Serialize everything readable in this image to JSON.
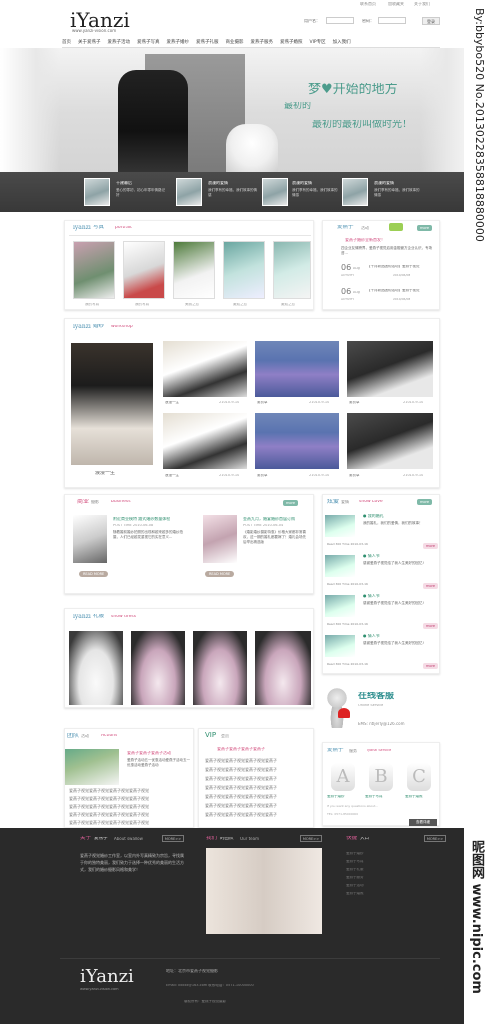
{
  "header": {
    "logo": "iYanzi",
    "logo_sub": "www.yanzi-vision.com",
    "toplinks": [
      "联系首页",
      "加收藏夹",
      "关于我们"
    ],
    "user_label": "用户名：",
    "pass_label": "密码：",
    "login_btn": "登录"
  },
  "nav": [
    "首页",
    "关于爱燕子",
    "爱燕子活动",
    "爱燕子写真",
    "爱燕子婚纱",
    "爱燕子礼服",
    "商业摄影",
    "爱燕子服务",
    "爱燕子婚照",
    "VIP专区",
    "加入我们"
  ],
  "banner": {
    "slogan1": "梦♥开始的地方",
    "slogan2": "最初的",
    "slogan3": "最初的最初叫做时光！",
    "strip_items": [
      {
        "title": "十建幕后",
        "desc": "爱心的零初，初心年零年情路记好"
      },
      {
        "title": "浪漫的爱情",
        "desc": "我们享有的幸福，我们故事的情感"
      },
      {
        "title": "浪漫的爱情",
        "desc": "我们享有的幸福，我们故事的情感"
      },
      {
        "title": "浪漫的爱情",
        "desc": "我们享有的幸福，我们故事的情感"
      }
    ]
  },
  "portrait": {
    "title_logo": "iyanzi",
    "title": "写真",
    "sub": "portrait",
    "captions": [
      "我的写真",
      "我的写真",
      "美丽之恋",
      "邂逅之恋",
      "邂逅之恋"
    ]
  },
  "activity": {
    "title": "爱燕子",
    "title2": "活动",
    "headline": "爱燕子婚纱全新首发！",
    "desc": "四企业友情跨界，爱燕子视觉启用金融管方企业认识，专场咨...",
    "items": [
      {
        "day": "06",
        "month": "Aug",
        "label": "ACTIVITY",
        "text": "【十月新品团购活动】爱燕子视觉",
        "date": "2010/06/08"
      },
      {
        "day": "06",
        "month": "Aug",
        "label": "ACTIVITY",
        "text": "【十月新品团购活动】爱燕子视觉",
        "date": "2010/06/08"
      }
    ]
  },
  "workshop": {
    "title_logo": "iyanzi",
    "title": "婚纱",
    "sub": "workshop",
    "main_caption": "浪漫一生",
    "captions": [
      {
        "name": "浪漫一生",
        "date": "21010-9-10"
      },
      {
        "name": "薰衣草",
        "date": "21010-9-10"
      },
      {
        "name": "薰衣草",
        "date": "21010-9-10"
      },
      {
        "name": "浪漫一生",
        "date": "21010-9-10"
      },
      {
        "name": "薰衣草",
        "date": "21010-9-10"
      },
      {
        "name": "薰衣草",
        "date": "21010-9-10"
      }
    ]
  },
  "business": {
    "title": "商业",
    "title2": "摄影",
    "sub": "business",
    "items": [
      {
        "head": "附近商业模特 路式婚纱数量体检",
        "time": "POST TIME 2010-06-08",
        "desc": "随着婚前婚纱拍照的出现和越来越多的婚纱拍摄，人们已经越发重视它的实在意义...",
        "btn": "READ MORE"
      },
      {
        "head": "金燕九月，婚宴婚纱首届订购",
        "time": "POST TIME 2010-06-04",
        "desc": "《婚影婚纱摄影特惠》价格大家都非常喜欢，这一期的婚礼都要嫁了！婚礼会场先后举出精选版",
        "btn": "READ MORE"
      }
    ]
  },
  "showlove": {
    "title": "炫爱",
    "title2": "爱情",
    "sub": "show Love",
    "items": [
      {
        "title": "● 我的婚礼",
        "desc": "我的婚礼，我们的爱情，我们的故事！",
        "read": "Read 300 Time 2010-03-16"
      },
      {
        "title": "● 情人节",
        "desc": "感谢爱燕子视觉给了我人生美好的回忆!",
        "read": "Read 300 Time 2010-03-16"
      },
      {
        "title": "● 情人节",
        "desc": "感谢爱燕子视觉给了我人生美好的回忆!",
        "read": "Read 300 Time 2010-03-16"
      },
      {
        "title": "● 情人节",
        "desc": "感谢爱燕子视觉给了我人生美好的回忆!",
        "read": "Read 300 Time 2010-03-16"
      }
    ],
    "more": "more"
  },
  "dress": {
    "title_logo": "iyanzi",
    "title": "礼服",
    "sub": "show dress"
  },
  "actions": {
    "title": "团队",
    "title2": "活动",
    "sub": "Actions",
    "headline": "爱燕子爱燕子爱燕子活动",
    "desc": "爱燕子活动五一优惠活动爱燕子活动五一优惠活动爱燕子活动",
    "list": [
      "爱燕子视觉爱燕子视觉爱燕子视觉爱燕子视觉",
      "爱燕子视觉爱燕子视觉爱燕子视觉爱燕子视觉",
      "爱燕子视觉爱燕子视觉爱燕子视觉爱燕子视觉",
      "爱燕子视觉爱燕子视觉爱燕子视觉爱燕子视觉",
      "爱燕子视觉爱燕子视觉爱燕子视觉爱燕子视觉"
    ]
  },
  "vip": {
    "title": "VIP",
    "title2": "会员",
    "headline": "爱燕子爱燕子爱燕子爱燕子",
    "list": [
      "爱燕子视觉爱燕子视觉爱燕子视觉爱燕子",
      "爱燕子视觉爱燕子视觉爱燕子视觉爱燕子",
      "爱燕子视觉爱燕子视觉爱燕子视觉爱燕子",
      "爱燕子视觉爱燕子视觉爱燕子视觉爱燕子",
      "爱燕子视觉爱燕子视觉爱燕子视觉爱燕子",
      "爱燕子视觉爱燕子视觉爱燕子视觉爱燕子",
      "爱燕子视觉爱燕子视觉爱燕子视觉爱燕子"
    ]
  },
  "online": {
    "title": "在线客服",
    "sub": "Online Service",
    "email": "EMS: ntljerly@126.com"
  },
  "service": {
    "title": "爱燕子",
    "title2": "服务",
    "sub": "iyanzi Service",
    "labels": [
      "爱燕子婚纱",
      "爱燕子写真",
      "爱燕子婚照"
    ],
    "desc": "If you want any questions about...",
    "tel": "TEL: 0571-85000000",
    "btn": "查看详细"
  },
  "footer": {
    "about_title": "关于",
    "about_title2": "爱燕子",
    "about_sub": "About swallow",
    "about_text": "爱燕子视觉婚纱工作室，以室内外写真精致为宗旨，寻找属于你的独特美丽，我们致力于选择一种优秀的美丽的生活方式，我们的婚纱摄影风格和美学！",
    "team_title": "我们",
    "team_title2": "的团队",
    "team_sub": "Our team",
    "quick_title": "快捷",
    "quick_title2": "入口",
    "more": "MORE>>",
    "quick_links": [
      "爱燕子婚纱",
      "爱燕子写真",
      "爱燕子礼服",
      "爱燕子服务",
      "爱燕子活动",
      "爱燕子婚照"
    ],
    "logo": "iYanzi",
    "logo_sub": "www.yanzi-vision.com",
    "addr": "地址：北京市爱燕子视觉摄影",
    "contact": "Email: xxxxx@163.com    联系电话：0571-10000000",
    "copy": "版权所有：爱燕子视觉摄影"
  },
  "watermark": {
    "side": "By:bbybo520 No.20130228358818880000",
    "nipic": "昵图网 www.nipic.com"
  }
}
